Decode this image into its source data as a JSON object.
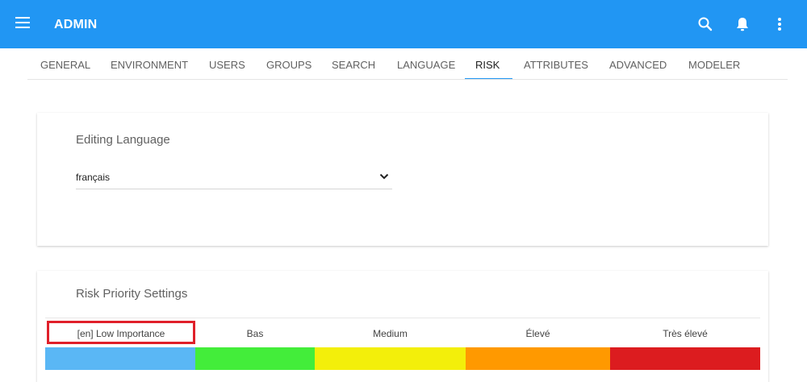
{
  "header": {
    "title": "ADMIN",
    "color": "#2196f3"
  },
  "tabs": [
    {
      "label": "GENERAL"
    },
    {
      "label": "ENVIRONMENT"
    },
    {
      "label": "USERS"
    },
    {
      "label": "GROUPS"
    },
    {
      "label": "SEARCH"
    },
    {
      "label": "LANGUAGE"
    },
    {
      "label": "RISK",
      "active": true
    },
    {
      "label": "ATTRIBUTES"
    },
    {
      "label": "ADVANCED"
    },
    {
      "label": "MODELER"
    }
  ],
  "editing_language": {
    "title": "Editing Language",
    "selected": "français"
  },
  "risk_priority": {
    "title": "Risk Priority Settings",
    "levels": [
      {
        "label": "[en] Low Importance",
        "color": "#5ab7f5",
        "highlighted": true
      },
      {
        "label": "Bas",
        "color": "#43ed3a"
      },
      {
        "label": "Medium",
        "color": "#f3ef0a"
      },
      {
        "label": "Élevé",
        "color": "#ff9900"
      },
      {
        "label": "Très élevé",
        "color": "#dc1c1f"
      }
    ]
  },
  "icons": {
    "menu": "menu-icon",
    "search": "search-icon",
    "notifications": "bell-icon",
    "more": "more-vertical-icon",
    "dropdown": "chevron-down-icon"
  }
}
